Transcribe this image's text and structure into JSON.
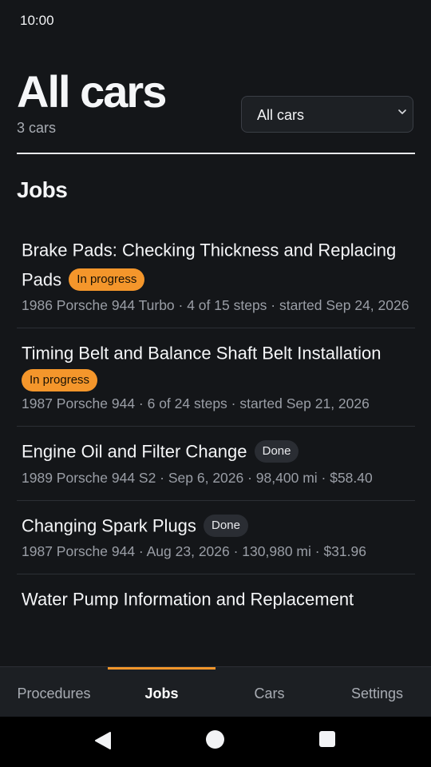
{
  "status_bar": {
    "time": "10:00"
  },
  "header": {
    "title": "All cars",
    "subtitle": "3 cars",
    "car_filter": {
      "selected": "All cars",
      "icon": "chevron-down-icon"
    }
  },
  "jobs_section": {
    "title": "Jobs"
  },
  "jobs": [
    {
      "title": "Brake Pads: Checking Thickness and Replacing Pads",
      "status": "In progress",
      "meta": "1986 Porsche 944 Turbo · 4 of 15 steps · started Sep 24, 2026"
    },
    {
      "title": "Timing Belt and Balance Shaft Belt Installation",
      "status": "In progress",
      "meta": "1987 Porsche 944 · 6 of 24 steps · started Sep 21, 2026"
    },
    {
      "title": "Engine Oil and Filter Change",
      "status": "Done",
      "meta": "1989 Porsche 944 S2 · Sep 6, 2026 · 98,400 mi · $58.40"
    },
    {
      "title": "Changing Spark Plugs",
      "status": "Done",
      "meta": "1987 Porsche 944 · Aug 23, 2026 · 130,980 mi · $31.96"
    },
    {
      "title": "Water Pump Information and Replacement",
      "status": "",
      "meta": ""
    }
  ],
  "tabs": [
    {
      "label": "Procedures",
      "active": false
    },
    {
      "label": "Jobs",
      "active": true
    },
    {
      "label": "Cars",
      "active": false
    },
    {
      "label": "Settings",
      "active": false
    }
  ],
  "system_nav": {
    "back_icon": "back-triangle-icon",
    "home_icon": "home-circle-icon",
    "recents_icon": "recents-square-icon"
  },
  "colors": {
    "background": "#141619",
    "accent": "#f4962b",
    "done_badge": "#2a2d33",
    "muted_text": "#9a9ea6"
  }
}
